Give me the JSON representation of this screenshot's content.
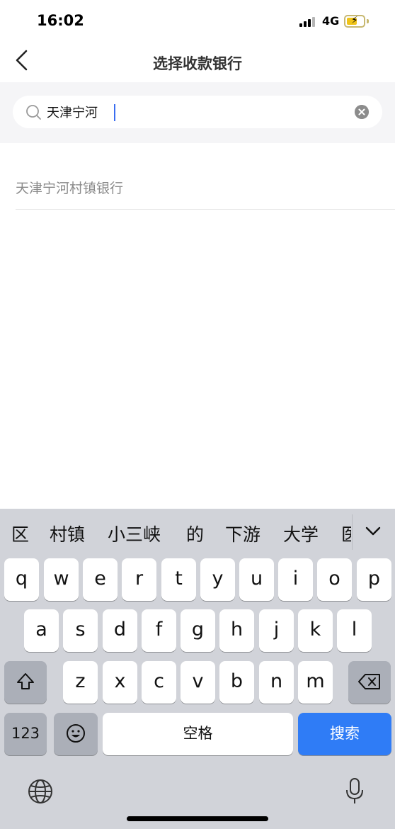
{
  "status": {
    "time": "16:02",
    "network": "4G"
  },
  "nav": {
    "title": "选择收款银行"
  },
  "search": {
    "value": "天津宁河"
  },
  "results": [
    {
      "name": "天津宁河村镇银行"
    }
  ],
  "keyboard": {
    "candidates": [
      "区",
      "村镇",
      "小三峡",
      "的",
      "下游",
      "大学",
      "医"
    ],
    "row1": [
      "q",
      "w",
      "e",
      "r",
      "t",
      "y",
      "u",
      "i",
      "o",
      "p"
    ],
    "row2": [
      "a",
      "s",
      "d",
      "f",
      "g",
      "h",
      "j",
      "k",
      "l"
    ],
    "row3": [
      "z",
      "x",
      "c",
      "v",
      "b",
      "n",
      "m"
    ],
    "numbers_label": "123",
    "space_label": "空格",
    "search_label": "搜索"
  },
  "colors": {
    "accent": "#2f7cf6",
    "keyboard_bg": "#d1d3d9",
    "search_bg": "#f5f5f7"
  }
}
